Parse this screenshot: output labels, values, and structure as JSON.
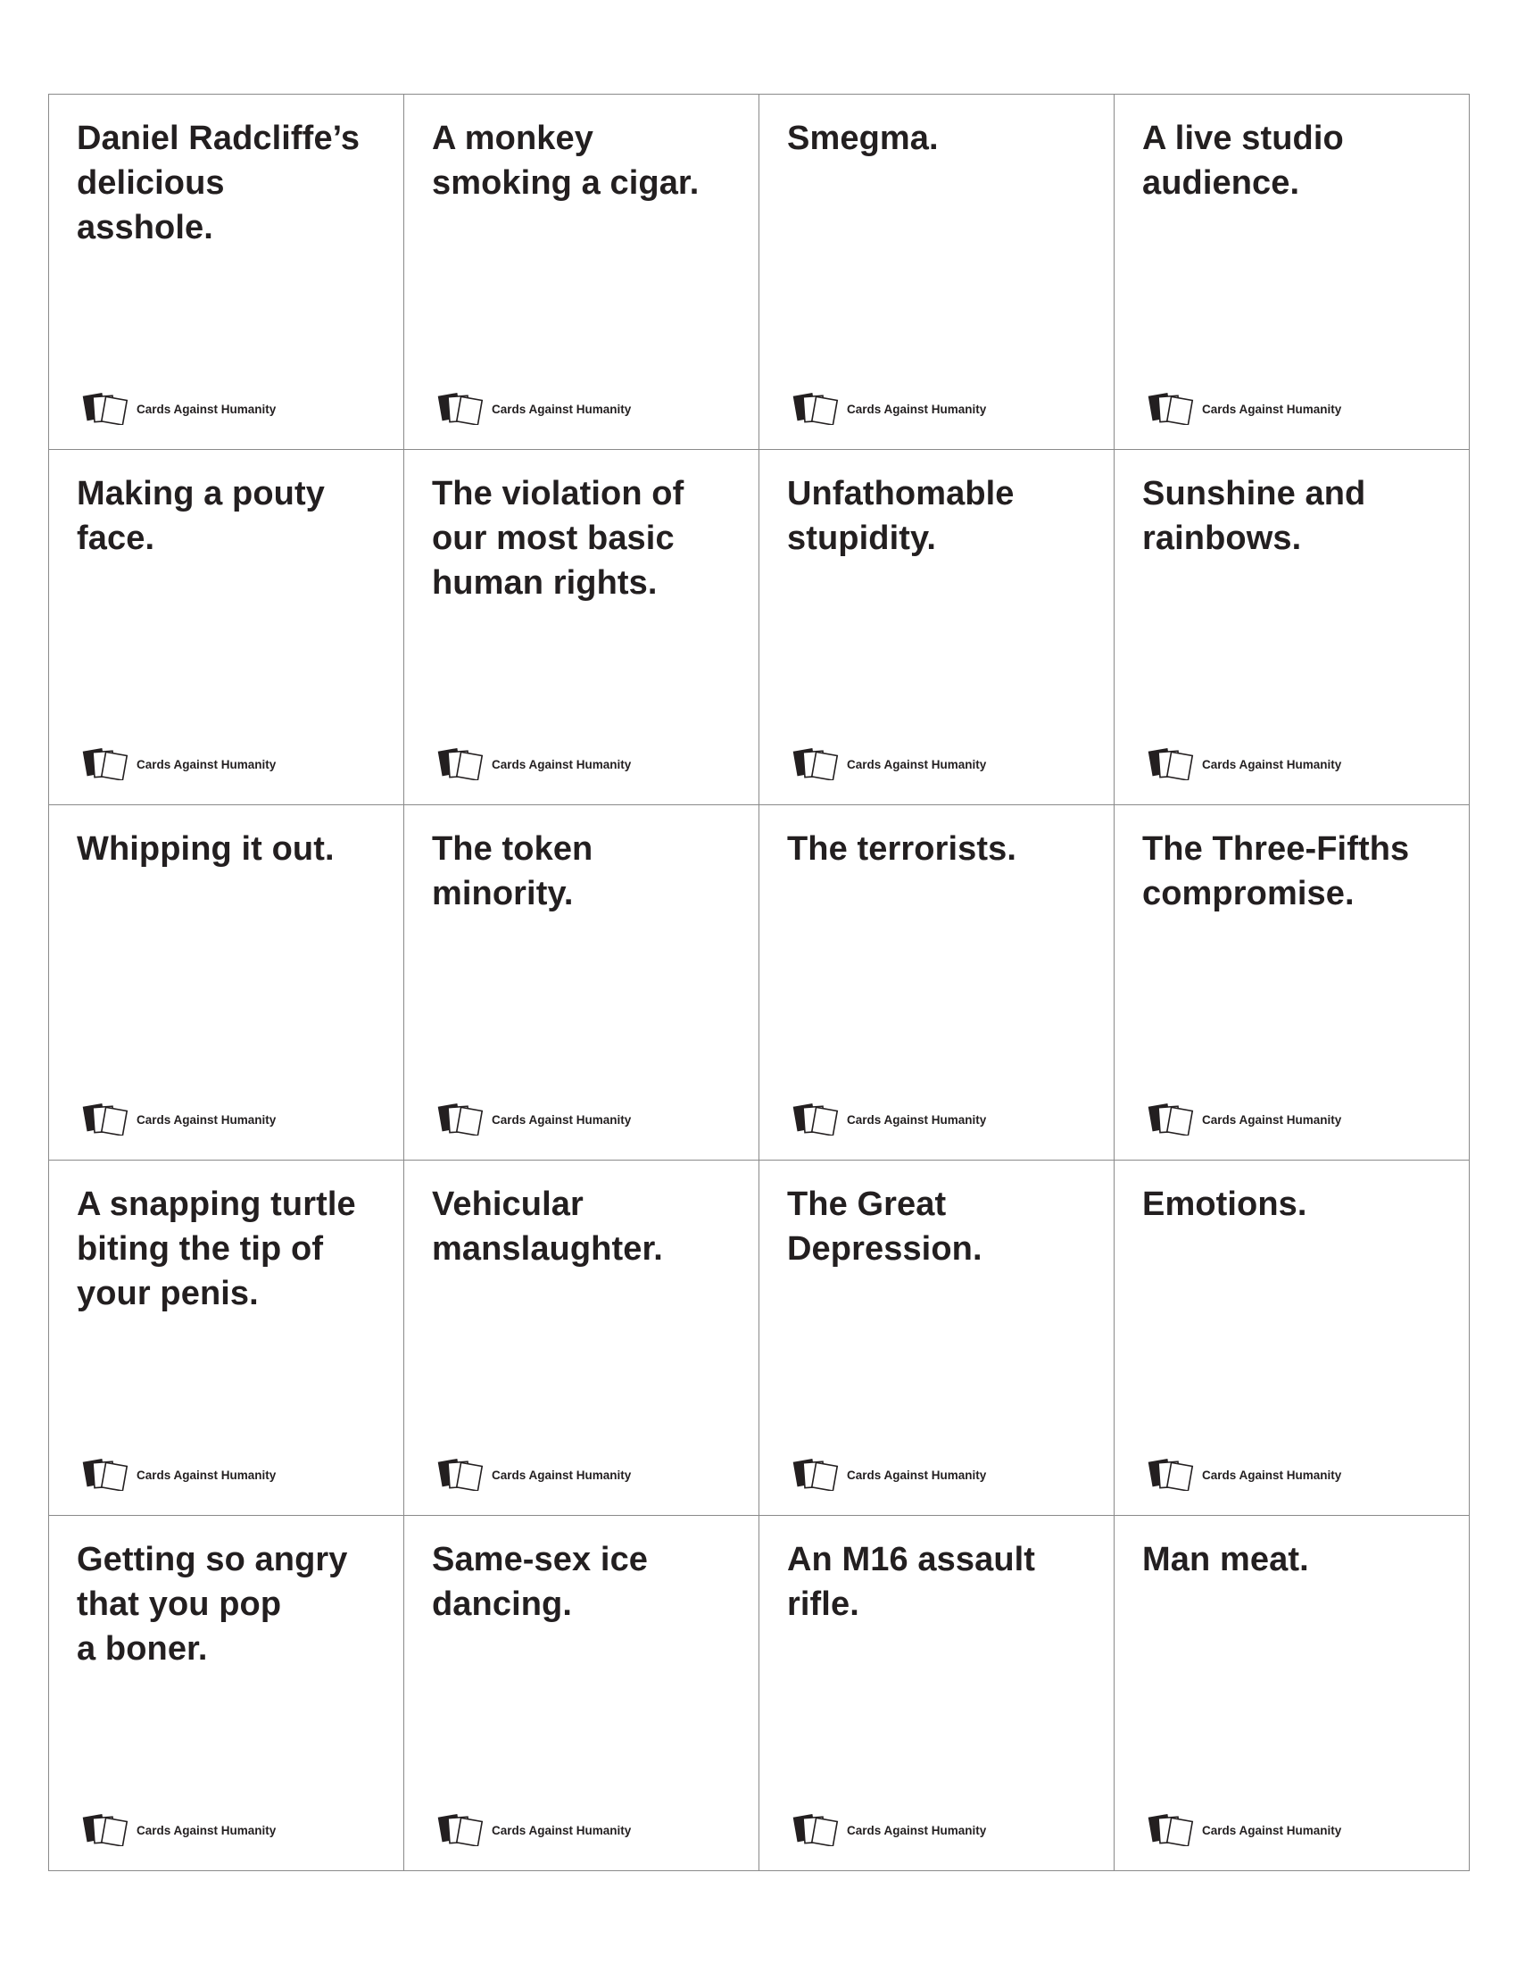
{
  "brand_label": "Cards Against Humanity",
  "cards": [
    {
      "text": "Daniel Radcliffe’s\ndelicious\nasshole."
    },
    {
      "text": "A monkey\nsmoking a cigar."
    },
    {
      "text": "Smegma."
    },
    {
      "text": "A live studio\naudience."
    },
    {
      "text": "Making a pouty\nface."
    },
    {
      "text": "The violation of\nour most basic\nhuman rights."
    },
    {
      "text": "Unfathomable\nstupidity."
    },
    {
      "text": "Sunshine and\nrainbows."
    },
    {
      "text": "Whipping it out."
    },
    {
      "text": "The token\nminority."
    },
    {
      "text": "The terrorists."
    },
    {
      "text": "The Three-Fifths\ncompromise."
    },
    {
      "text": "A snapping turtle\nbiting the tip of\nyour penis."
    },
    {
      "text": "Vehicular\nmanslaughter."
    },
    {
      "text": "The Great\nDepression."
    },
    {
      "text": "Emotions."
    },
    {
      "text": "Getting so angry\nthat you pop\na boner."
    },
    {
      "text": "Same-sex ice\ndancing."
    },
    {
      "text": "An M16 assault\nrifle."
    },
    {
      "text": "Man meat."
    }
  ]
}
